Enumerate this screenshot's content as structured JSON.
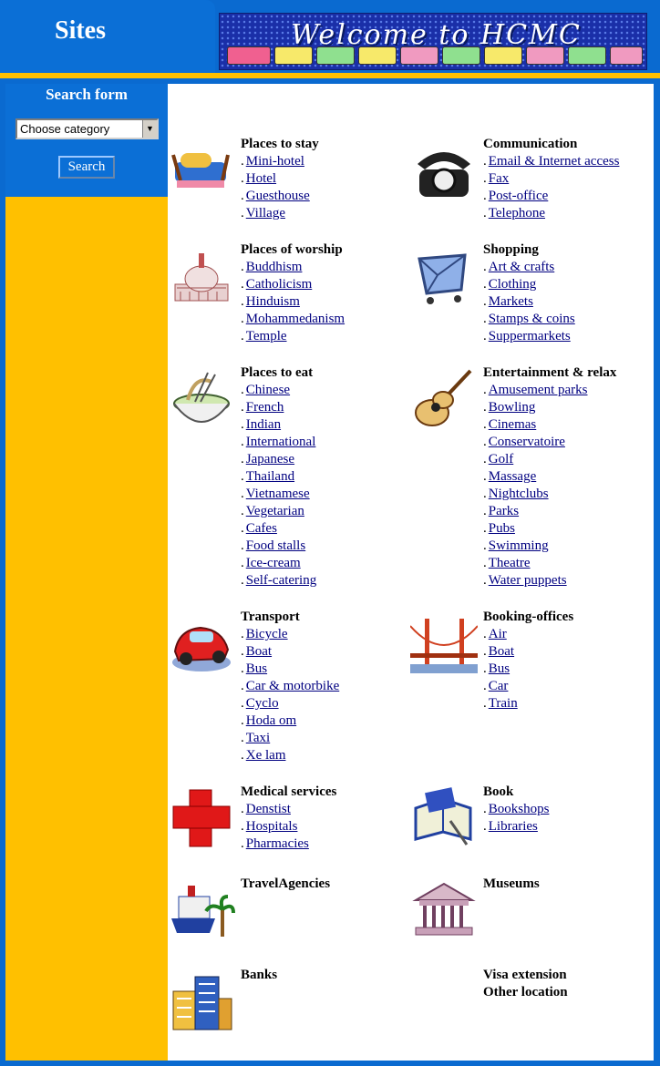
{
  "header": {
    "sites_label": "Sites",
    "banner_text": "Welcome to HCMC"
  },
  "search": {
    "title": "Search form",
    "category_value": "Choose category",
    "button_label": "Search"
  },
  "bullet": ".",
  "colors": {
    "frame_blue": "#0a6ad0",
    "sidebar_gold": "#ffc000",
    "link": "#000080"
  },
  "sections": [
    {
      "title": "Places to stay",
      "icon": "hotel-bed-icon",
      "links": [
        "Mini-hotel",
        "Hotel",
        "Guesthouse",
        "Village"
      ]
    },
    {
      "title": "Communication",
      "icon": "telephone-icon",
      "links": [
        "Email & Internet access",
        "Fax",
        "Post-office",
        "Telephone"
      ]
    },
    {
      "title": "Places of worship",
      "icon": "capitol-dome-icon",
      "links": [
        "Buddhism",
        "Catholicism",
        "Hinduism",
        "Mohammedanism",
        "Temple"
      ]
    },
    {
      "title": "Shopping",
      "icon": "shopping-cart-icon",
      "links": [
        "Art & crafts",
        "Clothing",
        "Markets",
        "Stamps & coins",
        "Suppermarkets"
      ]
    },
    {
      "title": "Places to eat",
      "icon": "noodle-bowl-icon",
      "links": [
        "Chinese",
        "French",
        "Indian",
        "International",
        "Japanese",
        "Thailand",
        "Vietnamese",
        "Vegetarian",
        "Cafes",
        "Food stalls",
        "Ice-cream",
        "Self-catering"
      ]
    },
    {
      "title": "Entertainment & relax",
      "icon": "guitar-icon",
      "links": [
        "Amusement parks",
        "Bowling",
        "Cinemas",
        "Conservatoire",
        "Golf",
        "Massage",
        "Nightclubs",
        "Parks",
        "Pubs",
        "Swimming",
        "Theatre",
        "Water puppets"
      ]
    },
    {
      "title": "Transport",
      "icon": "car-icon",
      "links": [
        "Bicycle",
        "Boat",
        "Bus",
        "Car & motorbike",
        "Cyclo",
        "Hoda om",
        "Taxi",
        "Xe lam"
      ]
    },
    {
      "title": "Booking-offices",
      "icon": "bridge-icon",
      "links": [
        "Air",
        "Boat",
        "Bus",
        "Car",
        "Train"
      ]
    },
    {
      "title": "Medical services",
      "icon": "red-cross-icon",
      "links": [
        "Denstist",
        "Hospitals",
        "Pharmacies"
      ]
    },
    {
      "title": "Book",
      "icon": "open-book-icon",
      "links": [
        "Bookshops",
        "Libraries"
      ]
    },
    {
      "title": "TravelAgencies",
      "icon": "ship-palm-icon",
      "links": []
    },
    {
      "title": "Museums",
      "icon": "museum-building-icon",
      "links": []
    },
    {
      "title": "Banks",
      "icon": "bank-buildings-icon",
      "links": []
    },
    {
      "title": "Visa extension",
      "icon": "",
      "links": []
    },
    {
      "title": "Other location",
      "icon": "",
      "links": []
    }
  ]
}
